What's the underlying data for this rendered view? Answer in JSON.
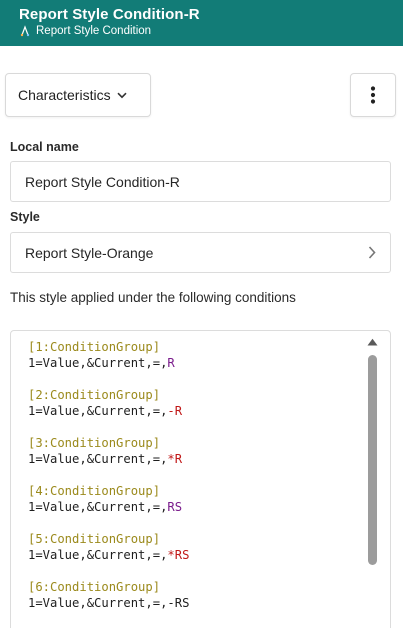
{
  "header": {
    "title": "Report Style Condition-R",
    "subtitle": "Report Style Condition",
    "icon": "condition-icon",
    "bg_color": "#127c77"
  },
  "toolbar": {
    "characteristics_label": "Characteristics",
    "more_icon": "kebab-menu-icon"
  },
  "local_name": {
    "label": "Local name",
    "value": "Report Style Condition-R"
  },
  "style": {
    "label": "Style",
    "value": "Report Style-Orange"
  },
  "conditions": {
    "description": "This style applied under the following conditions",
    "groups": [
      {
        "head": "[1:ConditionGroup]",
        "prefix": "1=Value,&Current,=,",
        "op": "",
        "val": "R"
      },
      {
        "head": "[2:ConditionGroup]",
        "prefix": "1=Value,&Current,=,",
        "op": "-",
        "val": "R"
      },
      {
        "head": "[3:ConditionGroup]",
        "prefix": "1=Value,&Current,=,",
        "op": "*",
        "val": "R"
      },
      {
        "head": "[4:ConditionGroup]",
        "prefix": "1=Value,&Current,=,",
        "op": "",
        "val": "RS"
      },
      {
        "head": "[5:ConditionGroup]",
        "prefix": "1=Value,&Current,=,",
        "op": "*",
        "val": "RS"
      },
      {
        "head": "[6:ConditionGroup]",
        "prefix": "1=Value,&Current,=,",
        "op": "-",
        "val": "RS"
      }
    ]
  }
}
